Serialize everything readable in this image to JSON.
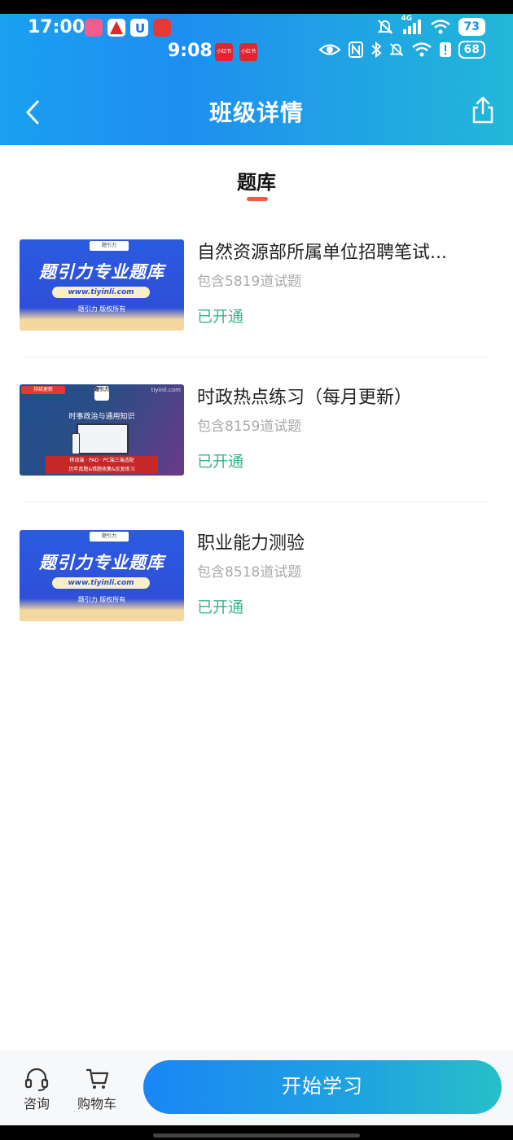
{
  "status_bar": {
    "time_primary": "17:00",
    "battery_primary": "73",
    "network_label": "4G",
    "time_secondary": "9:08",
    "battery_secondary": "68",
    "mini_app_label": "小红书"
  },
  "header": {
    "title": "班级详情"
  },
  "tabs": [
    {
      "label": "题库",
      "active": true
    }
  ],
  "courses": [
    {
      "title": "自然资源部所属单位招聘笔试...",
      "subtitle": "包含5819道试题",
      "status": "已开通",
      "thumbnail": {
        "brand": "题引力",
        "main_text": "题引力专业题库",
        "url": "www.tiyinli.com",
        "copyright": "题引力 版权所有"
      }
    },
    {
      "title": "时政热点练习（每月更新）",
      "subtitle": "包含8159道试题",
      "status": "已开通",
      "thumbnail": {
        "tag": "持续更新",
        "logo": "题引力",
        "site": "tiyinli.com",
        "sub_text": "时事政治与通用知识",
        "banner_line1": "移动端 · PAD · PC端三端适配",
        "banner_line2": "历年真题&错题收集&反复练习"
      }
    },
    {
      "title": "职业能力测验",
      "subtitle": "包含8518道试题",
      "status": "已开通",
      "thumbnail": {
        "brand": "题引力",
        "main_text": "题引力专业题库",
        "url": "www.tiyinli.com",
        "copyright": "题引力 版权所有"
      }
    }
  ],
  "bottom_bar": {
    "consult_label": "咨询",
    "cart_label": "购物车",
    "start_label": "开始学习"
  },
  "colors": {
    "header_gradient_start": "#1aa0f0",
    "header_gradient_end": "#22b7d8",
    "status_green": "#35b58d",
    "tab_underline": "#ee5c3c",
    "button_gradient_start": "#1a86f5",
    "button_gradient_end": "#27c0c8"
  }
}
